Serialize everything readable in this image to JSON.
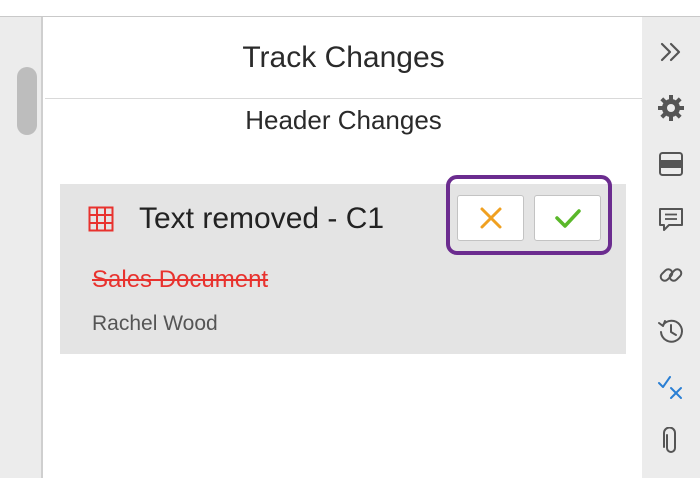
{
  "panel": {
    "title": "Track Changes",
    "section_title": "Header Changes"
  },
  "change": {
    "icon": "table-icon",
    "title": "Text removed - C1",
    "removed_text": "Sales Document",
    "author": "Rachel Wood",
    "removed_text_color": "#e8322e",
    "actions": {
      "reject_icon": "close-icon",
      "reject_color": "#f0a020",
      "accept_icon": "check-icon",
      "accept_color": "#5ab82a",
      "highlight_color": "#6b2c8f"
    }
  },
  "right_rail": {
    "icons": [
      "double-chevron-right-icon",
      "gear-icon",
      "header-footer-icon",
      "comment-icon",
      "link-icon",
      "history-icon",
      "track-changes-icon",
      "paperclip-icon"
    ],
    "active_icon_color": "#2a7fd4"
  }
}
